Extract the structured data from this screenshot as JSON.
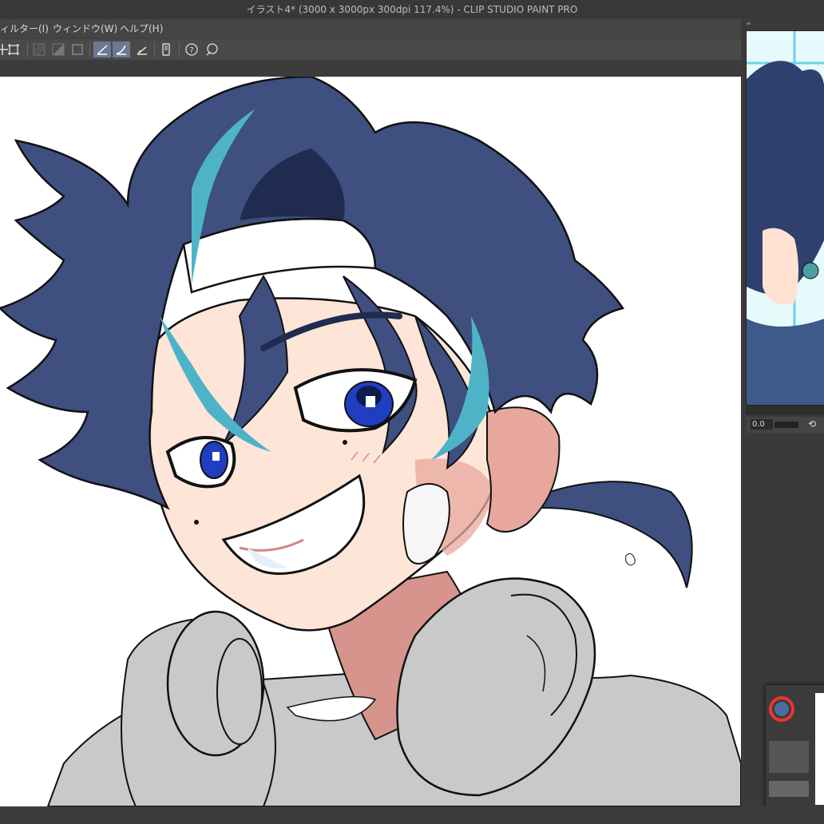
{
  "window": {
    "title": "イラスト4* (3000 x 3000px 300dpi 117.4%)  - CLIP STUDIO PAINT PRO"
  },
  "menu": {
    "items": [
      "ィルター(I)",
      "ウィンドウ(W)",
      "ヘルプ(H)"
    ]
  },
  "navigator": {
    "zoom_value": "0.0"
  },
  "colors": {
    "hair": "#3e4f80",
    "hair_shadow": "#1f2b4f",
    "highlight": "#4fb3c8",
    "skin": "#fde5d8",
    "skin_shadow": "#e8a79d",
    "hoodie": "#c9c9c9",
    "accent": "#6a7a95"
  },
  "icons": [
    "move-icon",
    "transform-icon",
    "ruler-off-icon",
    "ruler-half-icon",
    "frame-icon",
    "snap-ruler-icon",
    "snap-special-icon",
    "snap-grid-icon",
    "device-icon",
    "help-icon",
    "settings-icon"
  ]
}
